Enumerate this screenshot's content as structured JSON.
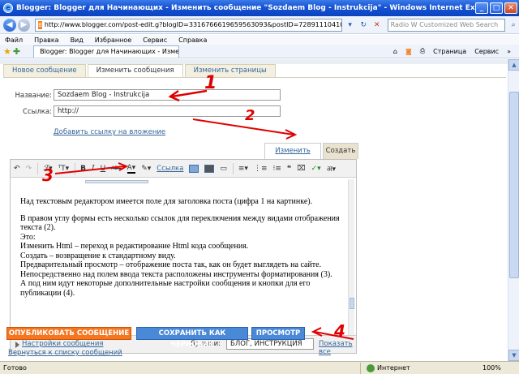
{
  "window": {
    "title": "Blogger: Blogger для Начинающих - Изменить сообщение \"Sozdaem Blog - Instrukcija\" - Windows Internet Explorer",
    "address": "http://www.blogger.com/post-edit.g?blogID=3316766619659563093&postID=7289111041063277666",
    "search_placeholder": "Radio W Customized Web Search",
    "browser_tab": "Blogger: Blogger для Начинающих - Изменить сообщ...",
    "toolbar_page": "Страница",
    "toolbar_service": "Сервис"
  },
  "menu": [
    "Файл",
    "Правка",
    "Вид",
    "Избранное",
    "Сервис",
    "Справка"
  ],
  "post_tabs": {
    "new": "Новое сообщение",
    "edit": "Изменить сообщения",
    "pages": "Изменить страницы"
  },
  "form": {
    "title_label": "Название:",
    "title_value": "Sozdaem Blog - Instrukcija",
    "link_label": "Ссылка:",
    "link_value": "http://",
    "add_attachment_link": "Добавить ссылку на вложение",
    "edit_html_tab": "Изменить HTML",
    "compose_tab": "Создать"
  },
  "editor_toolbar": {
    "link_label": "Ссылка"
  },
  "editor_content": [
    "Над текстовым редактором имеется поле для заголовка поста (цифра 1 на картинке).",
    "В правом углу формы есть несколько ссылок для переключения между видами отображения текста (2).",
    "Это:",
    "Изменить Html – переход в редактирование Html кода сообщения.",
    "Создать – возвращение к стандартному виду.",
    "Предварительный просмотр – отображение поста так, как он будет выглядеть на сайте.",
    "Непосредственно над полем ввода текста расположены инструменты форматирования (3).",
    "А под ним идут некоторые дополнительные настройки сообщения и кнопки для его публикации (4)."
  ],
  "post_options": {
    "settings_link": "Настройки сообщения",
    "labels_label": "Ярлыки:",
    "labels_value": "БЛОГ, ИНСТРУКЦИЯ",
    "show_all": "Показать все"
  },
  "buttons": {
    "publish": "ОПУБЛИКОВАТЬ СООБЩЕНИЕ",
    "save_draft": "СОХРАНИТЬ КАК ЧЕРНОВИК",
    "preview": "ПРОСМОТР"
  },
  "back_link": "Вернуться к списку сообщений",
  "status": {
    "left": "Готово",
    "zone": "Интернет",
    "zoom": "100%"
  },
  "annotations": [
    "1",
    "2",
    "3",
    "4"
  ],
  "colors": {
    "annotation": "#e00000",
    "publish_button": "#f5761f",
    "blue_button": "#4a88d8",
    "link": "#336699"
  }
}
